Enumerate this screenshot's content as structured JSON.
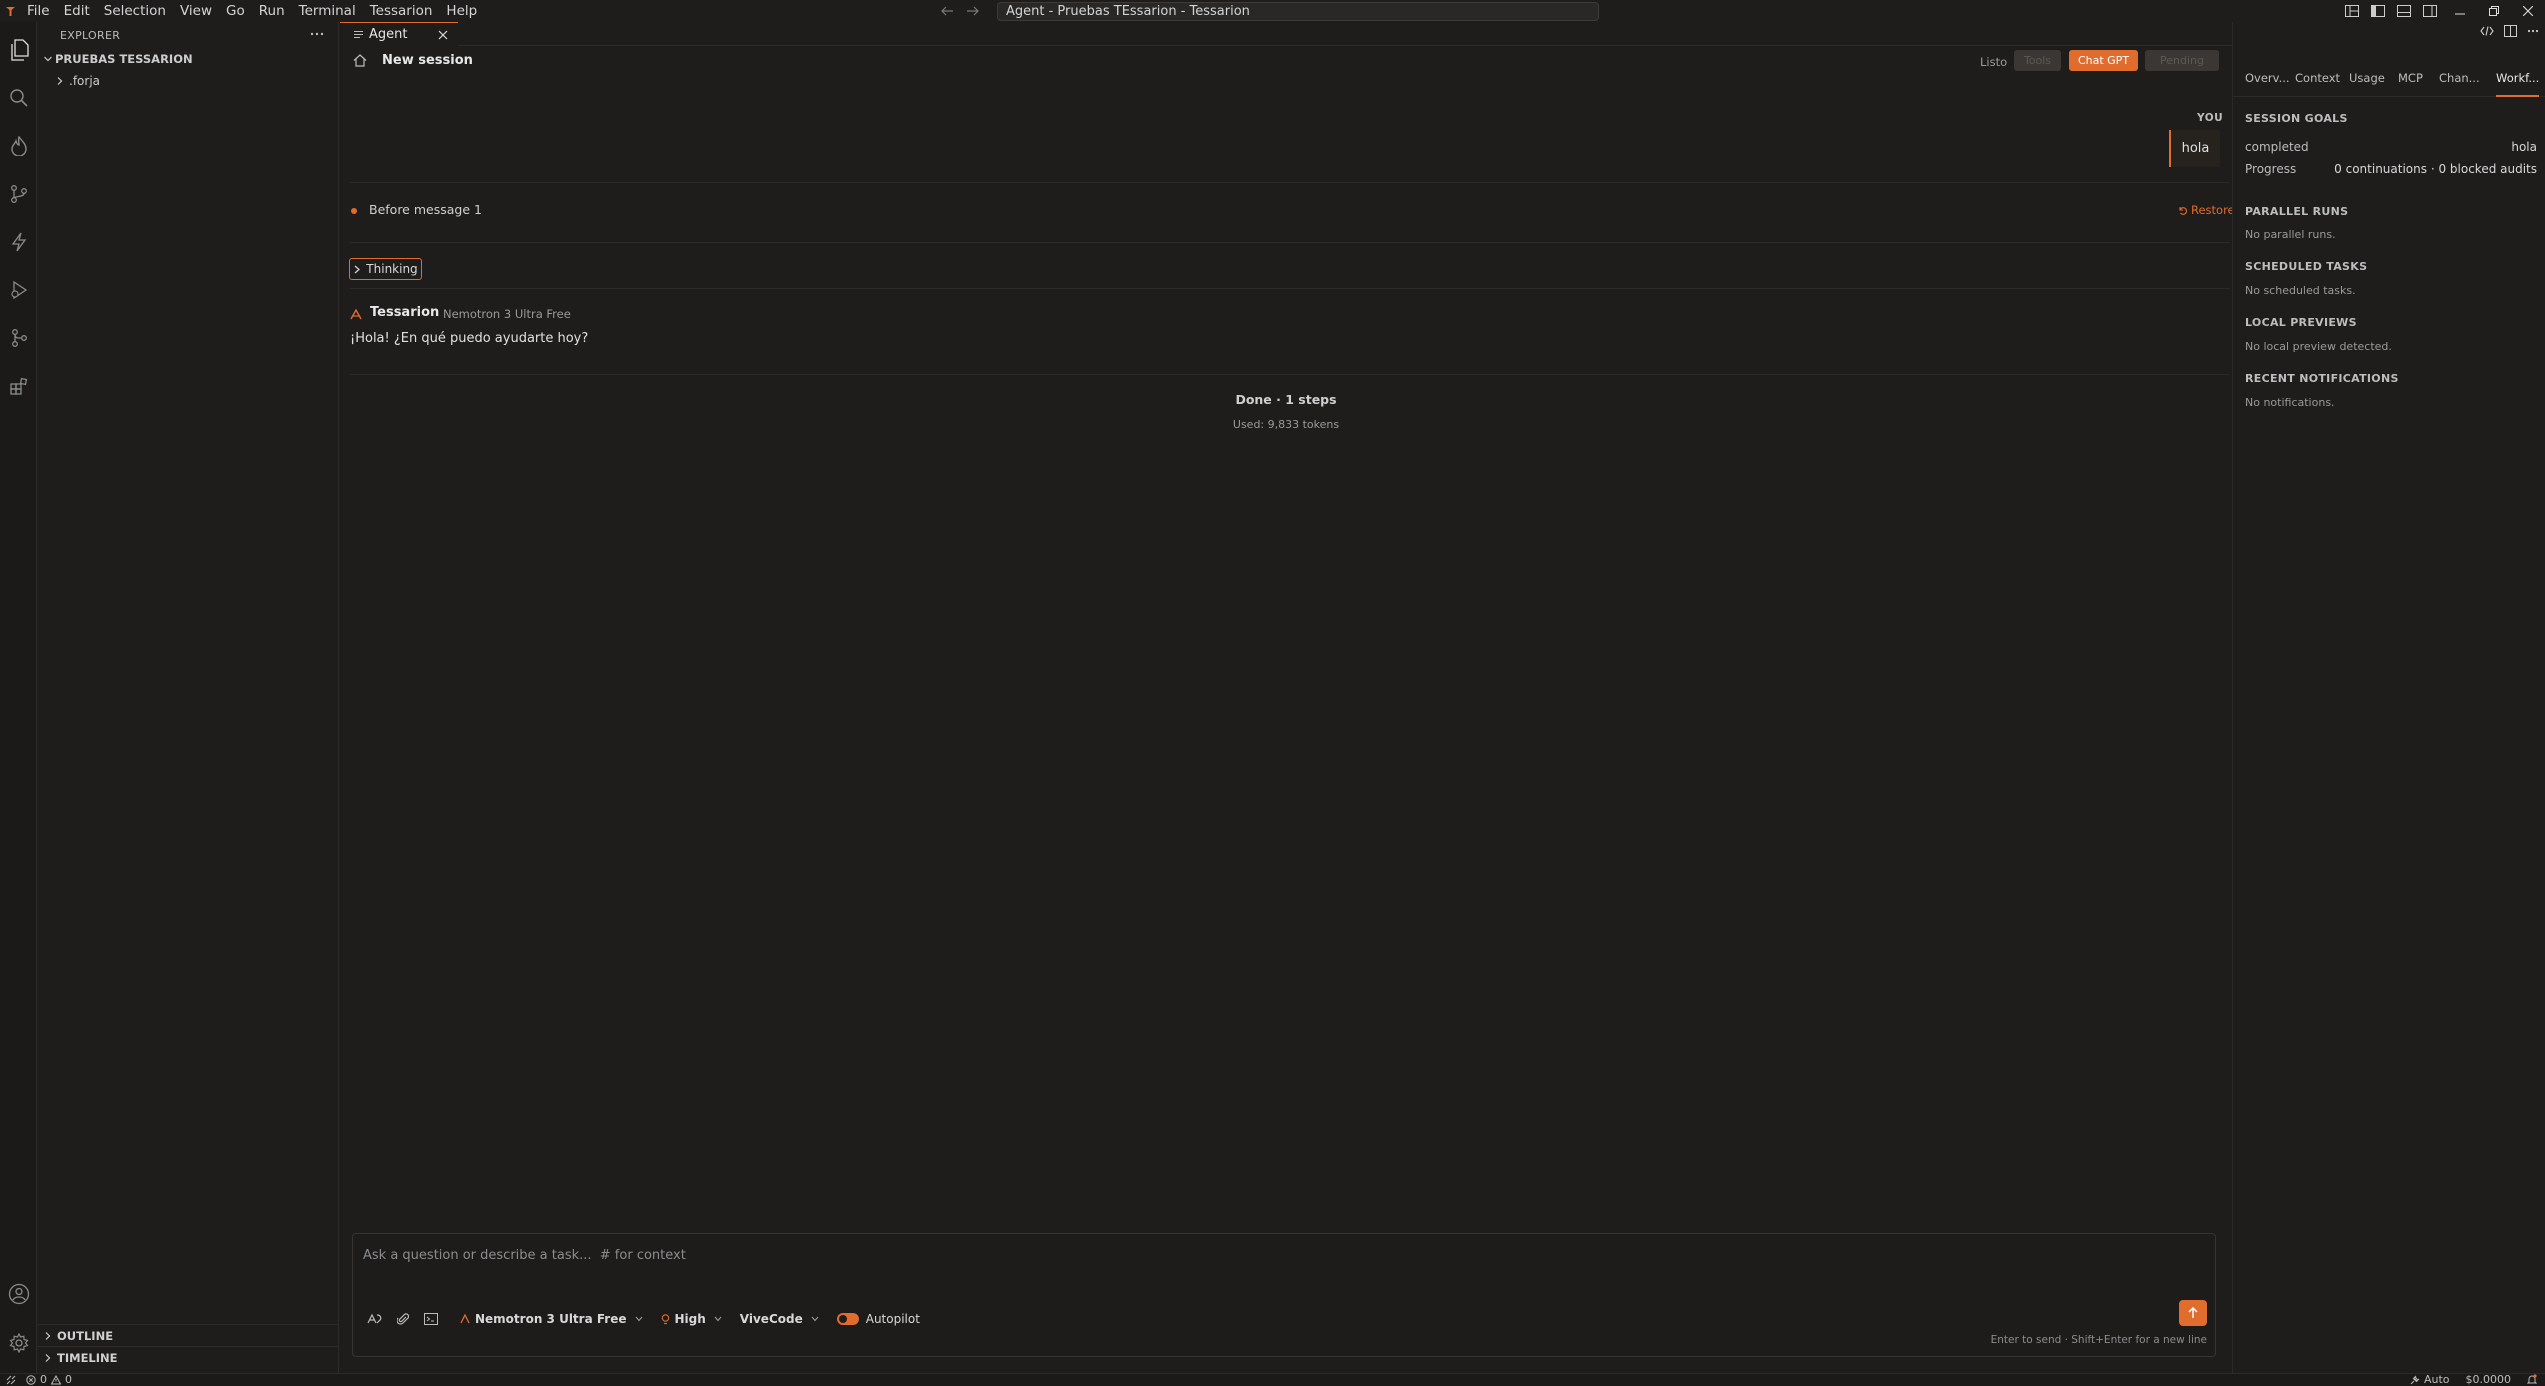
{
  "menu": [
    "File",
    "Edit",
    "Selection",
    "View",
    "Go",
    "Run",
    "Terminal",
    "Tessarion",
    "Help"
  ],
  "window_title": "Agent - Pruebas TEssarion - Tessarion",
  "explorer": {
    "header": "EXPLORER",
    "root_folder": "PRUEBAS TESSARION",
    "items": [
      ".forja"
    ],
    "outline": "OUTLINE",
    "timeline": "TIMELINE"
  },
  "editor": {
    "tab_label": "Agent",
    "session_title": "New session",
    "status": "Listo",
    "pill_left": "Tools",
    "pill_active": "Chat GPT",
    "pill_right": "Pending"
  },
  "conversation": {
    "you_label": "YOU",
    "user_message": "hola",
    "checkpoint_label": "Before message 1",
    "restore_label": "Restore",
    "thinking_label": "Thinking",
    "assistant_name": "Tessarion",
    "assistant_model": "Nemotron 3 Ultra Free",
    "assistant_message": "¡Hola! ¿En qué puedo ayudarte hoy?",
    "done_label": "Done · 1 steps",
    "tokens_label": "Used: 9,833 tokens"
  },
  "composer": {
    "placeholder": "Ask a question or describe a task...  # for context",
    "model": "Nemotron 3 Ultra Free",
    "effort": "High",
    "mode": "ViveCode",
    "autopilot_label": "Autopilot",
    "autopilot_on": true,
    "hint": "Enter to send · Shift+Enter for a new line"
  },
  "right_panel": {
    "tabs": [
      "Overv...",
      "Context",
      "Usage",
      "MCP",
      "Chan...",
      "Workf..."
    ],
    "active_tab": "Workf...",
    "session_goals": {
      "title": "SESSION GOALS",
      "rows": [
        {
          "label": "completed",
          "value": "hola"
        },
        {
          "label": "Progress",
          "value": "0 continuations · 0 blocked audits"
        }
      ]
    },
    "parallel_runs": {
      "title": "PARALLEL RUNS",
      "empty": "No parallel runs."
    },
    "scheduled_tasks": {
      "title": "SCHEDULED TASKS",
      "empty": "No scheduled tasks."
    },
    "local_previews": {
      "title": "LOCAL PREVIEWS",
      "empty": "No local preview detected."
    },
    "recent_notifications": {
      "title": "RECENT NOTIFICATIONS",
      "empty": "No notifications."
    }
  },
  "statusbar": {
    "errors": "0",
    "warnings": "0",
    "mode": "Auto",
    "cost": "$0.0000"
  },
  "colors": {
    "accent": "#e06c2e",
    "background": "#1f1d1c",
    "panel_border": "#2c2a28"
  }
}
